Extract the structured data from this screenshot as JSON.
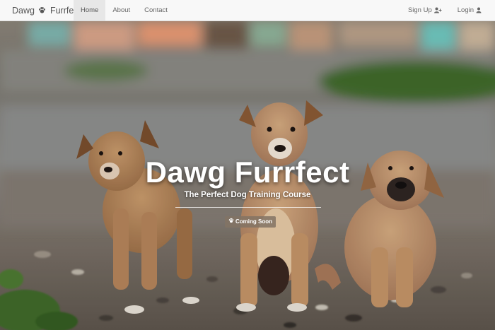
{
  "navbar": {
    "brand": {
      "text_before": "Dawg",
      "text_after": "Furrfect",
      "icon": "paw-icon"
    },
    "links": [
      {
        "label": "Home",
        "active": true
      },
      {
        "label": "About",
        "active": false
      },
      {
        "label": "Contact",
        "active": false
      }
    ],
    "right": {
      "signup": {
        "label": "Sign Up",
        "icon": "user-plus-icon"
      },
      "login": {
        "label": "Login",
        "icon": "user-icon"
      }
    }
  },
  "hero": {
    "title": "Dawg Furrfect",
    "subtitle": "The Perfect Dog Training Course",
    "badge": {
      "label": "Coming Soon",
      "icon": "paw-icon"
    },
    "background": "three-puppies-photo"
  }
}
